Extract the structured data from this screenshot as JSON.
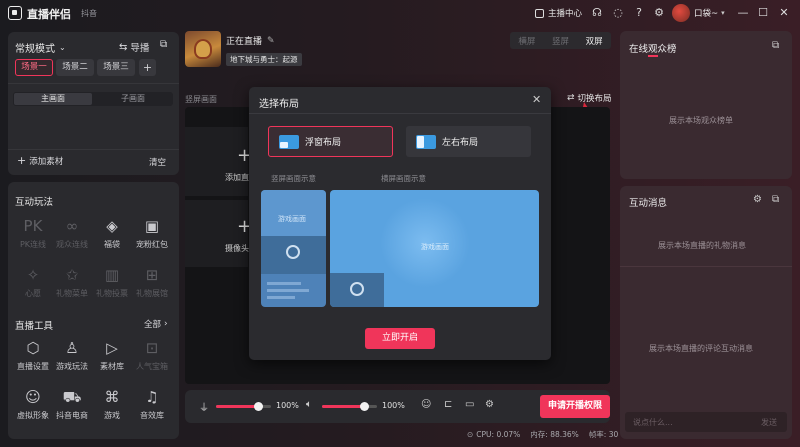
{
  "app": {
    "name": "直播伴侣",
    "platform": "抖音"
  },
  "titlebar": {
    "host_center": "主播中心",
    "user_name": "口袋~"
  },
  "scene": {
    "mode": "常规模式",
    "guide": "导播",
    "tabs": [
      "场景一",
      "场景二",
      "场景三"
    ],
    "add": "+"
  },
  "screen_tabs": {
    "main": "主画面",
    "sub": "子画面"
  },
  "source_bar": {
    "add_material": "添加素材",
    "clear": "清空"
  },
  "interactive": {
    "title": "互动玩法",
    "items": [
      "PK连线",
      "观众连线",
      "福袋",
      "宠粉红包",
      "心愿",
      "礼物菜单",
      "礼物投票",
      "礼物展馆"
    ]
  },
  "live_tools": {
    "title": "直播工具",
    "all": "全部",
    "items": [
      "直播设置",
      "游戏玩法",
      "素材库",
      "人气宝箱",
      "虚拟形象",
      "抖音电商",
      "游戏",
      "音效库"
    ]
  },
  "stream": {
    "status": "正在直播",
    "tag": "地下城与勇士：起源",
    "orient": [
      "横屏",
      "竖屏",
      "双屏"
    ]
  },
  "preview": {
    "label": "竖屏画面",
    "switch_layout": "切换布局",
    "add_text": "添加直",
    "camera_text": "摄像头"
  },
  "dialog": {
    "title": "选择布局",
    "options": [
      "浮窗布局",
      "左右布局"
    ],
    "left_caption": "竖屏画面示意",
    "right_caption": "横屏画面示意",
    "game_text_left": "游戏画面",
    "game_text_right": "游戏画面",
    "confirm": "立即开启"
  },
  "bottom": {
    "mic_volume": "100%",
    "speaker_volume": "100%",
    "mic_level": 0.77,
    "speaker_level": 0.77,
    "apply_button": "申请开播权限"
  },
  "stats": {
    "cpu": "CPU: 0.07%",
    "mem": "内存: 88.36%",
    "fps": "帧率: 30"
  },
  "rank": {
    "title": "在线观众榜",
    "empty": "展示本场观众榜单"
  },
  "messages": {
    "title": "互动消息",
    "gift_empty": "展示本场直播的礼物消息",
    "comment_empty": "展示本场直播的评论互动消息",
    "input_placeholder": "说点什么...",
    "send": "发送"
  },
  "colors": {
    "accent": "#f0355a",
    "highlight": "#ff4d6d",
    "dialog_blue": "#3b8fd6"
  }
}
